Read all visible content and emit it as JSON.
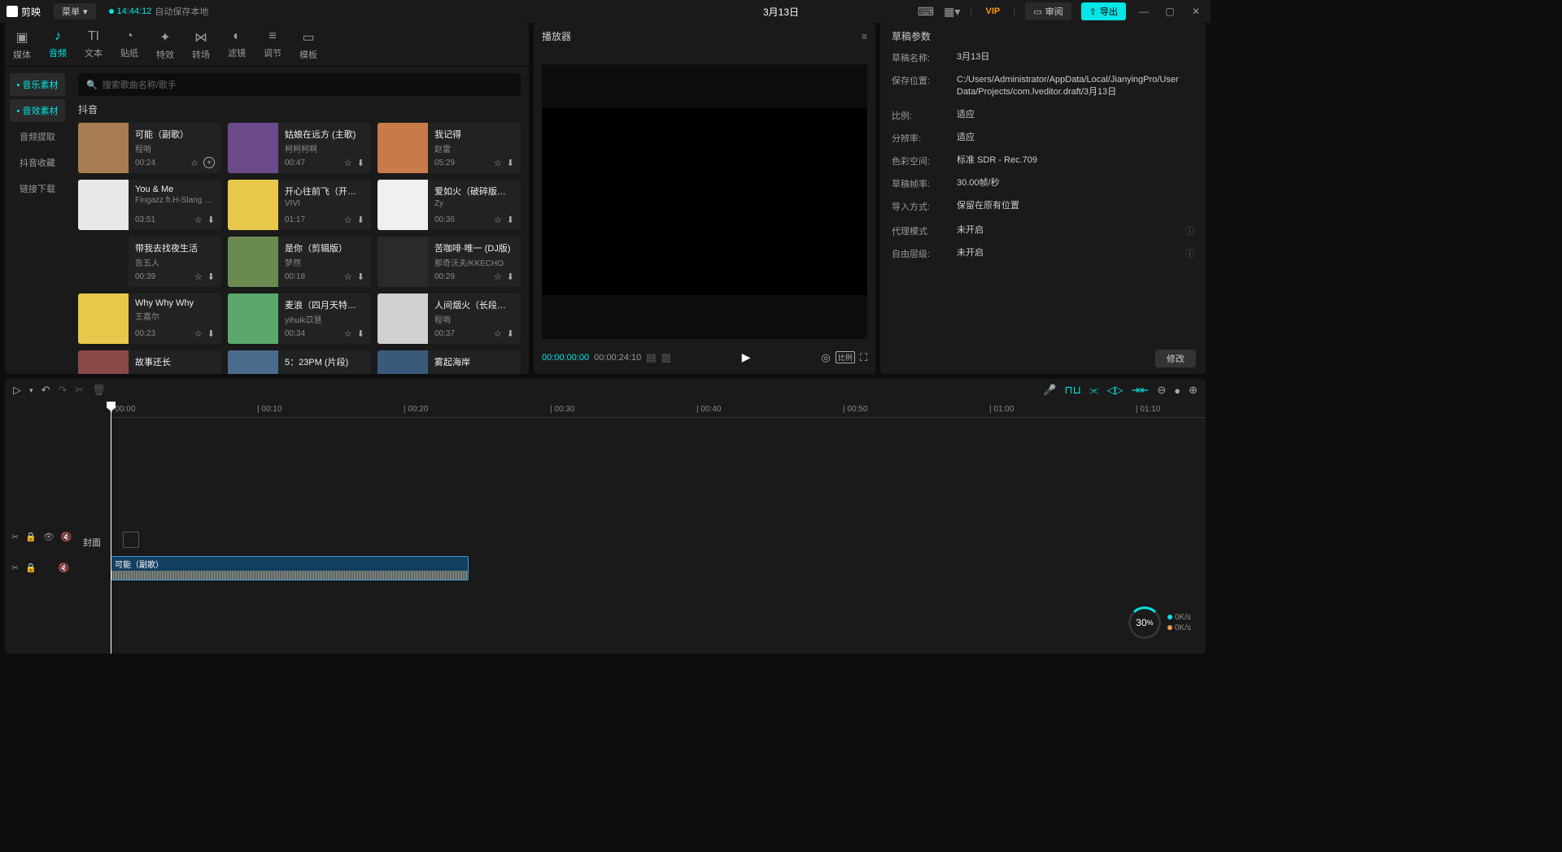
{
  "titlebar": {
    "app_name": "剪映",
    "menu_label": "菜单",
    "autosave_time": "14:44:12",
    "autosave_text": "自动保存本地",
    "project_title": "3月13日",
    "vip": "VIP",
    "review": "审阅",
    "export": "导出"
  },
  "asset_tabs": [
    {
      "icon": "▣",
      "label": "媒体"
    },
    {
      "icon": "♪",
      "label": "音频"
    },
    {
      "icon": "TI",
      "label": "文本"
    },
    {
      "icon": "◔",
      "label": "贴纸"
    },
    {
      "icon": "✦",
      "label": "特效"
    },
    {
      "icon": "⋈",
      "label": "转场"
    },
    {
      "icon": "◐",
      "label": "滤镜"
    },
    {
      "icon": "≡",
      "label": "调节"
    },
    {
      "icon": "▭",
      "label": "模板"
    }
  ],
  "sidebar": {
    "items": [
      "音乐素材",
      "音效素材",
      "音频提取",
      "抖音收藏",
      "链接下载"
    ]
  },
  "search": {
    "placeholder": "搜索歌曲名称/歌手"
  },
  "category": "抖音",
  "music": [
    {
      "title": "可能（副歌）",
      "artist": "程哨",
      "dur": "00:24",
      "thumb": "#a87c52"
    },
    {
      "title": "姑娘在远方 (主歌)",
      "artist": "柯柯柯啊",
      "dur": "00:47",
      "thumb": "#6b4a8a"
    },
    {
      "title": "我记得",
      "artist": "赵雷",
      "dur": "05:29",
      "thumb": "#c97a4a"
    },
    {
      "title": "You & Me",
      "artist": "Fingazz ft.H-Slang & Choco",
      "dur": "03:51",
      "thumb": "#e8e8e8"
    },
    {
      "title": "开心往前飞（开心超人联盟主题曲）",
      "artist": "VIVI",
      "dur": "01:17",
      "thumb": "#e8c84a"
    },
    {
      "title": "爱如火（破碎版）- Zy",
      "artist": "Zy",
      "dur": "00:36",
      "thumb": "#f0f0f0"
    },
    {
      "title": "带我去找夜生活",
      "artist": "告五人",
      "dur": "00:39",
      "thumb": "#1a1a1a"
    },
    {
      "title": "是你（剪辑版）",
      "artist": "梦然",
      "dur": "00:18",
      "thumb": "#6b8a52"
    },
    {
      "title": "苦咖啡·唯一 (DJ版)",
      "artist": "那奇沃夫/KKECHO",
      "dur": "00:29",
      "thumb": "#2a2a2a"
    },
    {
      "title": "Why Why Why",
      "artist": "王嘉尔",
      "dur": "00:23",
      "thumb": "#e8c84a"
    },
    {
      "title": "麦浪（四月天特别版）",
      "artist": "yihuik苡慧",
      "dur": "00:34",
      "thumb": "#5aa86b"
    },
    {
      "title": "人间烟火（长段落）",
      "artist": "程哨",
      "dur": "00:37",
      "thumb": "#d0d0d0"
    },
    {
      "title": "故事还长",
      "artist": "",
      "dur": "",
      "thumb": "#8a4a4a"
    },
    {
      "title": "5：23PM (片段)",
      "artist": "",
      "dur": "",
      "thumb": "#4a6b8a"
    },
    {
      "title": "雾起海岸",
      "artist": "",
      "dur": "",
      "thumb": "#3a5a7a"
    }
  ],
  "player": {
    "title": "播放器",
    "current": "00:00:00:00",
    "total": "00:00:24:10"
  },
  "props": {
    "title": "草稿参数",
    "rows": [
      {
        "label": "草稿名称:",
        "value": "3月13日"
      },
      {
        "label": "保存位置:",
        "value": "C:/Users/Administrator/AppData/Local/JianyingPro/User Data/Projects/com.lveditor.draft/3月13日"
      },
      {
        "label": "比例:",
        "value": "适应"
      },
      {
        "label": "分辨率:",
        "value": "适应"
      },
      {
        "label": "色彩空间:",
        "value": "标准 SDR - Rec.709"
      },
      {
        "label": "草稿帧率:",
        "value": "30.00帧/秒"
      },
      {
        "label": "导入方式:",
        "value": "保留在原有位置"
      },
      {
        "label": "代理模式",
        "value": "未开启"
      },
      {
        "label": "自由层级:",
        "value": "未开启"
      }
    ],
    "modify": "修改"
  },
  "timeline": {
    "ticks": [
      "00:00",
      "00:10",
      "00:20",
      "00:30",
      "00:40",
      "00:50",
      "01:00",
      "01:10"
    ],
    "cover_label": "封面",
    "clip_label": "可能（副歌）"
  },
  "perf": {
    "pct": "30",
    "unit": "%",
    "up": "0K/s",
    "down": "0K/s"
  }
}
